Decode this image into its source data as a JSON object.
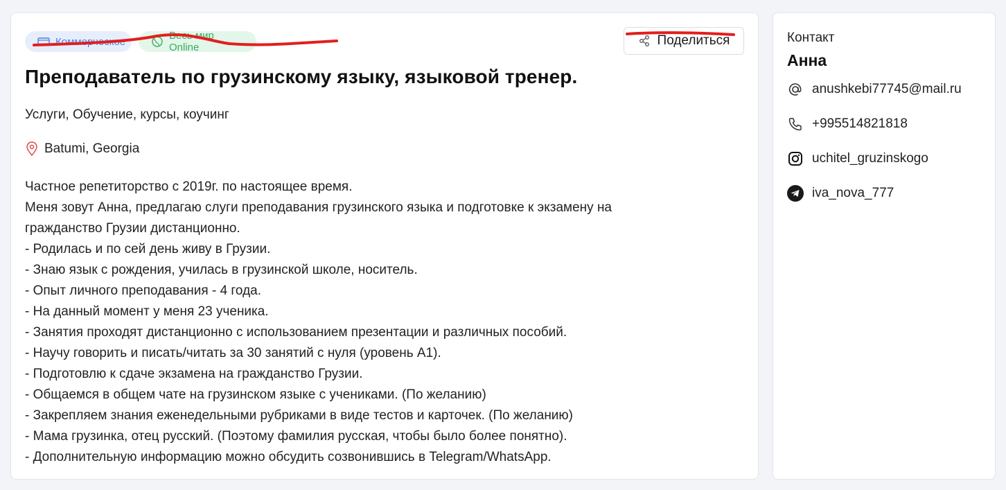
{
  "tags": [
    {
      "label": "Коммерческое",
      "icon": "banknote-icon",
      "color": "#4a7fe0",
      "bg": "#e7eefb"
    },
    {
      "label": "Весь мир Online",
      "icon": "globe-icon",
      "color": "#3daa5f",
      "bg": "#e3f6ea"
    }
  ],
  "share": {
    "label": "Поделиться",
    "icon": "share-icon"
  },
  "listing": {
    "title": "Преподаватель по грузинскому языку, языковой тренер.",
    "category": "Услуги, Обучение, курсы, коучинг",
    "location": "Batumi, Georgia",
    "description": [
      "Частное репетиторство с 2019г. по настоящее время.",
      "Меня зовут Анна, предлагаю слуги преподавания грузинского языка и подготовке к экзамену на",
      "гражданство Грузии дистанционно.",
      "- Родилась и по сей день живу в Грузии.",
      "- Знаю язык с рождения, училась в грузинской школе, носитель.",
      "- Опыт личного преподавания - 4 года.",
      "- На данный момент у меня 23 ученика.",
      "- Занятия проходят дистанционно с использованием презентации и различных пособий.",
      "- Научу говорить и писать/читать за 30 занятий с нуля (уровень А1).",
      "- Подготовлю к сдаче экзамена на гражданство Грузии.",
      "- Общаемся в общем чате на грузинском языке с учениками. (По желанию)",
      "- Закрепляем знания еженедельными рубриками в виде тестов и карточек. (По желанию)",
      "- Мама грузинка, отец русский. (Поэтому фамилия русская, чтобы было более понятно).",
      "- Дополнительную информацию можно обсудить созвонившись в Telegram/WhatsApp."
    ]
  },
  "contact": {
    "heading": "Контакт",
    "name": "Анна",
    "email": "anushkebi77745@mail.ru",
    "phone": "+995514821818",
    "instagram": "uchitel_gruzinskogo",
    "telegram": "iva_nova_777"
  },
  "colors": {
    "accent_red": "#e21e1e",
    "location_pin": "#e04848"
  }
}
